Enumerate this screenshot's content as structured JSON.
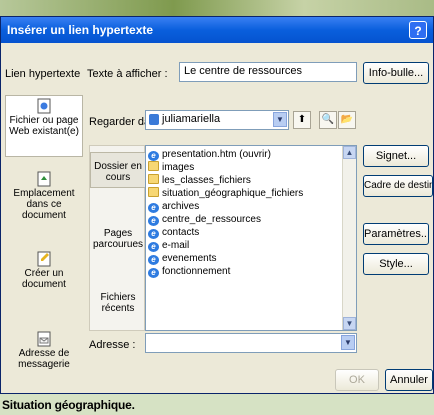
{
  "background": {
    "caption": "Situation géographique."
  },
  "window": {
    "title": "Insérer un lien hypertexte",
    "help_label": "?"
  },
  "header": {
    "link_label": "Lien hypertexte",
    "text_to_display_label": "Texte à afficher :",
    "text_to_display_value": "Le centre de ressources",
    "tooltip_button": "Info-bulle..."
  },
  "sidebar": {
    "items": [
      {
        "label": "Fichier ou page Web existant(e)",
        "icon": "web-page-icon"
      },
      {
        "label": "Emplacement dans ce document",
        "icon": "document-location-icon"
      },
      {
        "label": "Créer un document",
        "icon": "new-document-icon"
      },
      {
        "label": "Adresse de messagerie",
        "icon": "email-icon"
      }
    ]
  },
  "lookin": {
    "label": "Regarder dans :",
    "value": "juliamariella"
  },
  "bookmarks": {
    "items": [
      "Dossier en cours",
      "Pages parcourues",
      "Fichiers récents"
    ]
  },
  "files": [
    {
      "name": "presentation.htm (ouvrir)",
      "type": "ie"
    },
    {
      "name": "images",
      "type": "folder"
    },
    {
      "name": "les_classes_fichiers",
      "type": "folder"
    },
    {
      "name": "situation_géographique_fichiers",
      "type": "folder"
    },
    {
      "name": "archives",
      "type": "ie"
    },
    {
      "name": "centre_de_ressources",
      "type": "ie"
    },
    {
      "name": "contacts",
      "type": "ie"
    },
    {
      "name": "e-mail",
      "type": "ie"
    },
    {
      "name": "evenements",
      "type": "ie"
    },
    {
      "name": "fonctionnement",
      "type": "ie"
    }
  ],
  "right_buttons": {
    "bookmark": "Signet...",
    "target_frame": "Cadre de destination...",
    "parameters": "Paramètres...",
    "style": "Style..."
  },
  "address": {
    "label": "Adresse :",
    "value": ""
  },
  "footer": {
    "ok": "OK",
    "cancel": "Annuler"
  }
}
